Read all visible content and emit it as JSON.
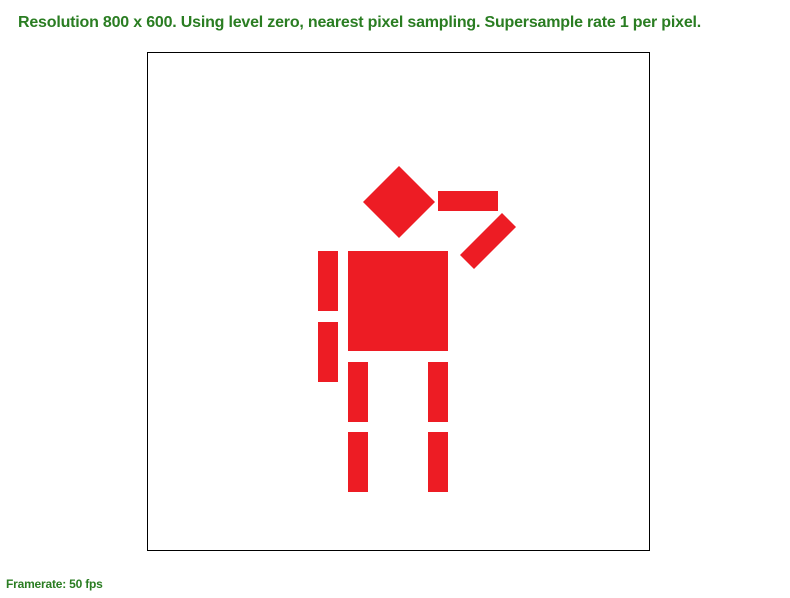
{
  "status": {
    "text": "Resolution 800 x 600. Using level zero, nearest pixel sampling. Supersample rate 1 per pixel.",
    "color": "#2a7d22"
  },
  "framerate": {
    "text": "Framerate: 50 fps",
    "color": "#2a7d22"
  },
  "scene": {
    "figure_color": "#ed1c24",
    "border_color": "#000000",
    "background": "#ffffff"
  }
}
